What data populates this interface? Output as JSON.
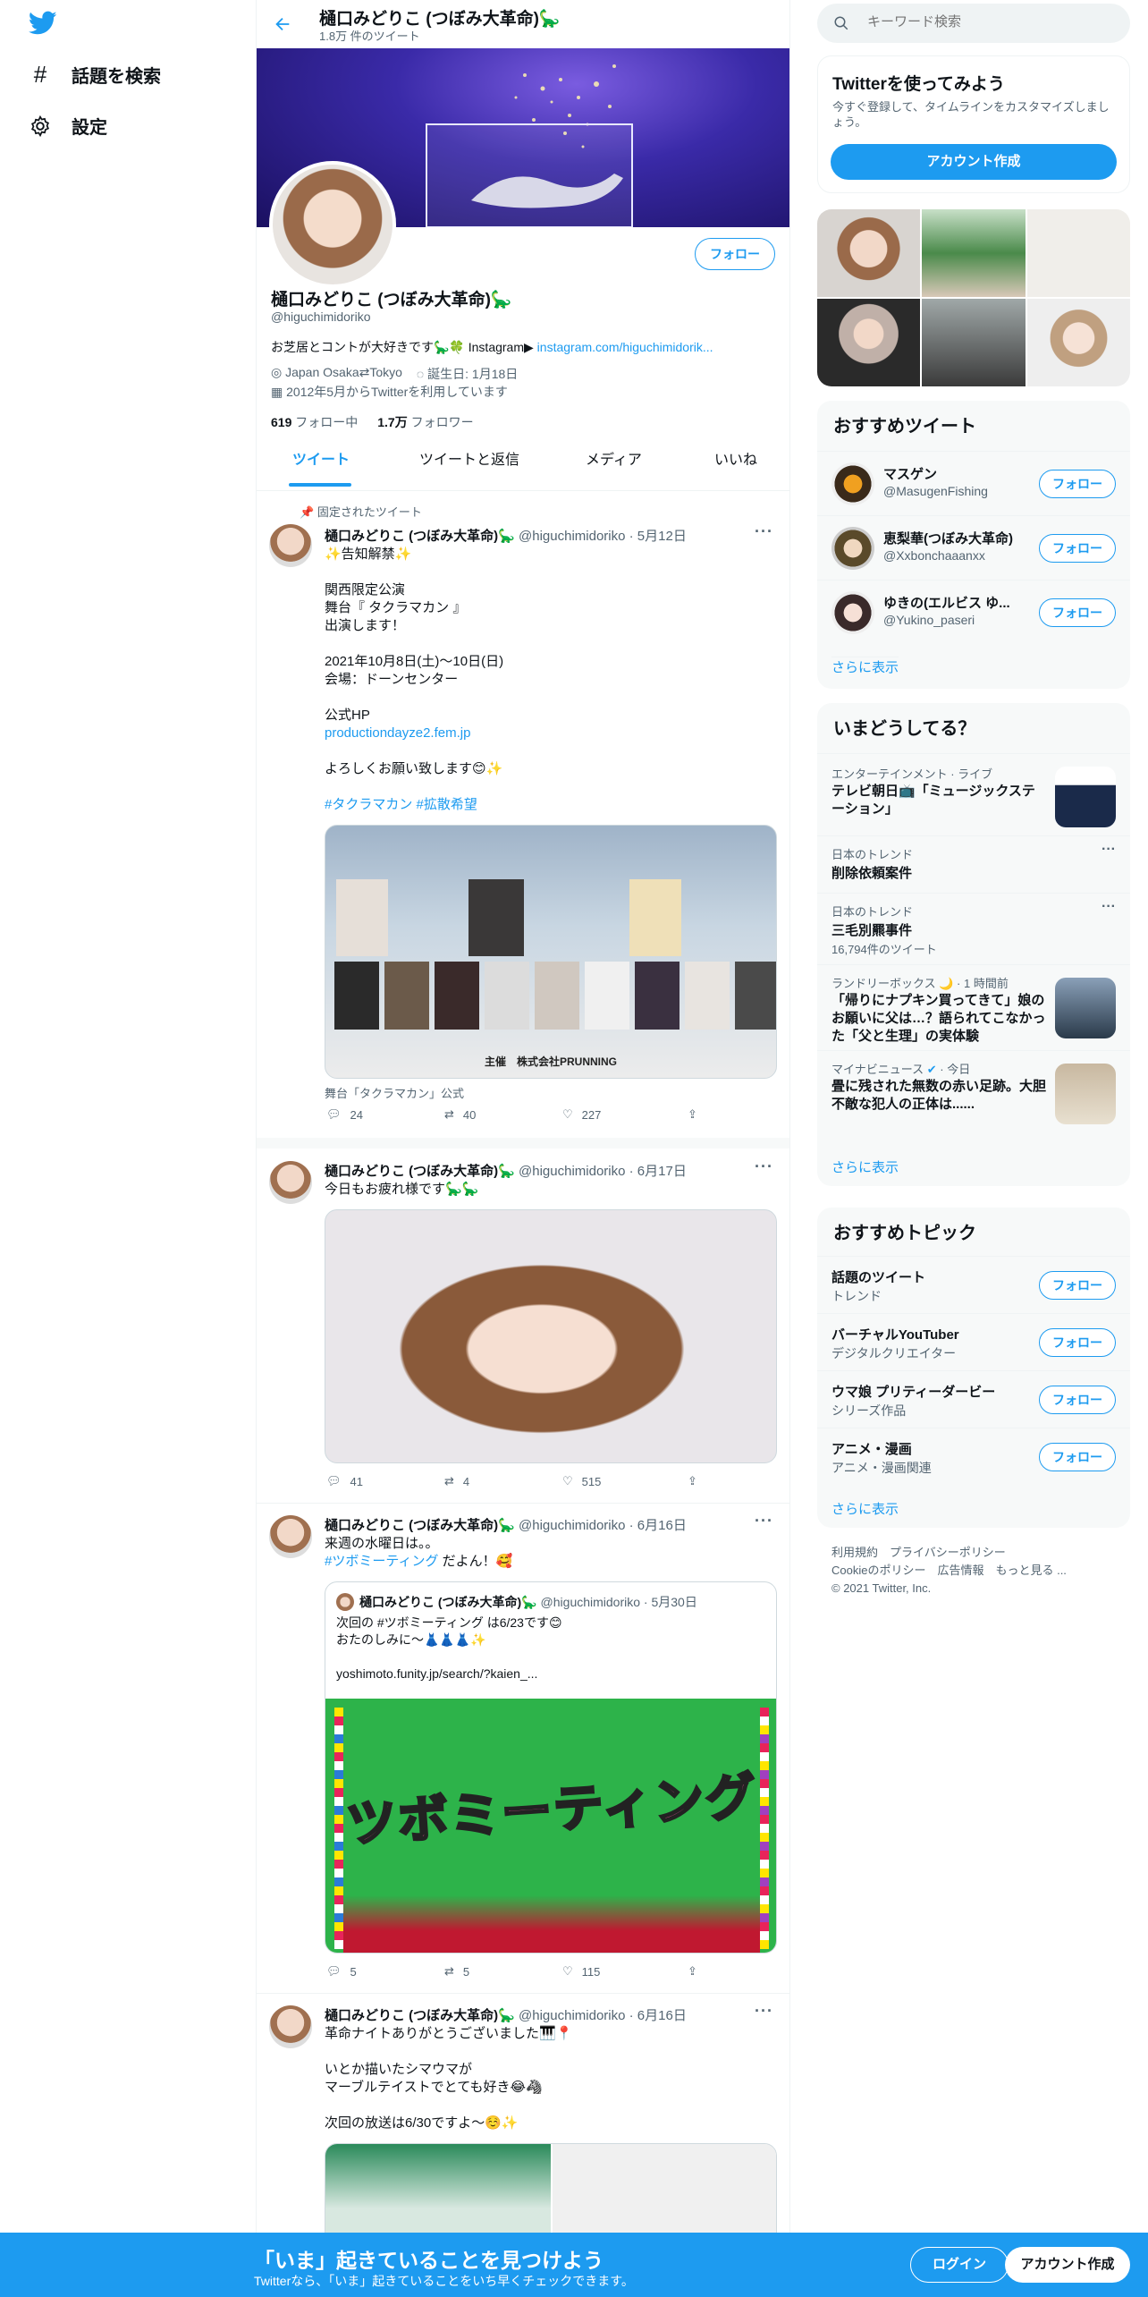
{
  "nav": {
    "explore_label": "話題を検索",
    "settings_label": "設定"
  },
  "header": {
    "title": "樋口みどりこ (つぼみ大革命)🦕",
    "tweet_count": "1.8万 件のツイート"
  },
  "profile": {
    "name": "樋口みどりこ (つぼみ大革命)🦕",
    "handle": "@higuchimidoriko",
    "follow_label": "フォロー",
    "bio": "お芝居とコントが大好きです🦕🍀 Instagram▶",
    "bio_link": "instagram.com/higuchimidorik...",
    "location": "Japan Osaka⇄Tokyo",
    "birthday": "誕生日: 1月18日",
    "joined": "2012年5月からTwitterを利用しています",
    "following_count": "619",
    "following_label": "フォロー中",
    "followers_count": "1.7万",
    "followers_label": "フォロワー"
  },
  "tabs": [
    "ツイート",
    "ツイートと返信",
    "メディア",
    "いいね"
  ],
  "tweets": [
    {
      "pinned": "固定されたツイート",
      "name": "樋口みどりこ (つぼみ大革命)🦕",
      "meta": "@higuchimidoriko · 5月12日",
      "text": "✨告知解禁✨\n\n関西限定公演\n舞台『 タクラマカン 』\n出演します！\n\n2021年10月8日(土)〜10日(日)\n会場：ドーンセンター\n\n公式HP",
      "link": "productiondayze2.fem.jp",
      "text2": "よろしくお願い致します😊✨",
      "hashtags": "#タクラマカン #拡散希望",
      "caption": "舞台「タクラマカン」公式",
      "poster_footer": "主催　株式会社PRUNNING",
      "replies": "24",
      "retweets": "40",
      "likes": "227"
    },
    {
      "name": "樋口みどりこ (つぼみ大革命)🦕",
      "meta": "@higuchimidoriko · 6月17日",
      "text": "今日もお疲れ様です🦕🦕",
      "replies": "41",
      "retweets": "4",
      "likes": "515"
    },
    {
      "name": "樋口みどりこ (つぼみ大革命)🦕",
      "meta": "@higuchimidoriko · 6月16日",
      "text": "来週の水曜日は。。",
      "hashtag_line": "#ツボミーティング",
      "hashtag_suffix": " だよん！🥰",
      "quote_name": "樋口みどりこ (つぼみ大革命)🦕",
      "quote_meta": "@higuchimidoriko · 5月30日",
      "quote_text": "次回の #ツボミーティング は6/23です😊\nおたのしみに〜👗👗👗✨\n\nyoshimoto.funity.jp/search/?kaien_...",
      "quote_image_text": "ツボミーティング",
      "replies": "5",
      "retweets": "5",
      "likes": "115"
    },
    {
      "name": "樋口みどりこ (つぼみ大革命)🦕",
      "meta": "@higuchimidoriko · 6月16日",
      "text": "革命ナイトありがとうございました🎹📍\n\nいとか描いたシマウマが\nマーブルテイストでとても好き😂🦓\n\n次回の放送は6/30ですよ〜☺️✨"
    }
  ],
  "search": {
    "placeholder": "キーワード検索"
  },
  "signup": {
    "title": "Twitterを使ってみよう",
    "desc": "今すぐ登録して、タイムラインをカスタマイズしましょう。",
    "button": "アカウント作成"
  },
  "recommended": {
    "title": "おすすめツイート",
    "users": [
      {
        "name": "マスゲン",
        "handle": "@MasugenFishing",
        "follow": "フォロー"
      },
      {
        "name": "恵梨華(つぼみ大革命)",
        "handle": "@Xxbonchaaanxx",
        "follow": "フォロー"
      },
      {
        "name": "ゆきの(エルビス ゆ...",
        "handle": "@Yukino_paseri",
        "follow": "フォロー"
      }
    ],
    "more": "さらに表示"
  },
  "trends": {
    "title": "いまどうしてる？",
    "items": [
      {
        "category": "エンターテインメント · ライブ",
        "title": "テレビ朝日📺「ミュージックステーション」"
      },
      {
        "category": "日本のトレンド",
        "title": "削除依頼案件"
      },
      {
        "category": "日本のトレンド",
        "title": "三毛別羆事件",
        "count": "16,794件のツイート"
      },
      {
        "category": "ランドリーボックス 🌙",
        "time": "· 1 時間前",
        "title": "「帰りにナプキン買ってきて」娘のお願いに父は…？語られてこなかった「父と生理」の実体験"
      },
      {
        "category": "マイナビニュース",
        "time": "· 今日",
        "title": "畳に残された無数の赤い足跡。大胆不敵な犯人の正体は......"
      }
    ],
    "more": "さらに表示"
  },
  "topics": {
    "title": "おすすめトピック",
    "items": [
      {
        "name": "話題のツイート",
        "sub": "トレンド",
        "follow": "フォロー"
      },
      {
        "name": "バーチャルYouTuber",
        "sub": "デジタルクリエイター",
        "follow": "フォロー"
      },
      {
        "name": "ウマ娘 プリティーダービー",
        "sub": "シリーズ作品",
        "follow": "フォロー"
      },
      {
        "name": "アニメ・漫画",
        "sub": "アニメ・漫画関連",
        "follow": "フォロー"
      }
    ],
    "more": "さらに表示"
  },
  "footer": {
    "line1": "利用規約　プライバシーポリシー",
    "line2": "Cookieのポリシー　広告情報　もっと見る ...",
    "line3": "© 2021 Twitter, Inc."
  },
  "bottom": {
    "title": "「いま」起きていることを見つけよう",
    "sub": "Twitterなら、「いま」起きていることをいち早くチェックできます。",
    "login": "ログイン",
    "signup": "アカウント作成"
  },
  "colors": {
    "accent": "#1d9bf0",
    "bottom_bar": "#1d9bf0",
    "quote_image_bg": "#2db34a"
  }
}
